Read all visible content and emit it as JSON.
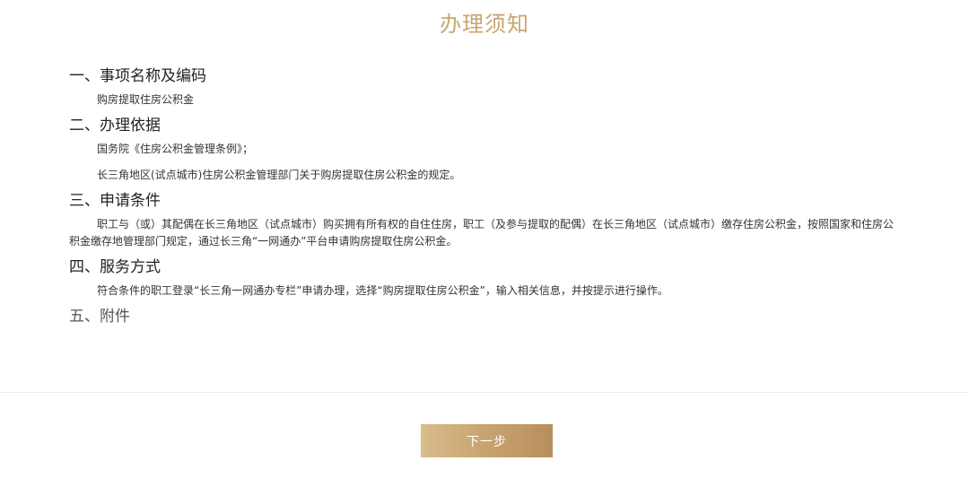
{
  "page": {
    "title": "办理须知"
  },
  "sections": [
    {
      "heading": "一、事项名称及编码",
      "paragraphs": [
        "购房提取住房公积金"
      ]
    },
    {
      "heading": "二、办理依据",
      "paragraphs": [
        "国务院《住房公积金管理条例》；",
        "长三角地区(试点城市)住房公积金管理部门关于购房提取住房公积金的规定。"
      ]
    },
    {
      "heading": "三、申请条件",
      "paragraphs": [
        "职工与（或）其配偶在长三角地区（试点城市）购买拥有所有权的自住住房，职工（及参与提取的配偶）在长三角地区（试点城市）缴存住房公积金，按照国家和住房公积金缴存地管理部门规定，通过长三角“一网通办”平台申请购房提取住房公积金。"
      ]
    },
    {
      "heading": "四、服务方式",
      "paragraphs": [
        "符合条件的职工登录“长三角一网通办专栏”申请办理，选择“购房提取住房公积金”，输入相关信息，并按提示进行操作。"
      ]
    },
    {
      "heading": "五、附件",
      "paragraphs": []
    }
  ],
  "footer": {
    "next_button_label": "下一步"
  },
  "colors": {
    "accent": "#c8a573",
    "button_gradient_start": "#d9bc8b",
    "button_gradient_end": "#b78f5d",
    "divider": "#ececec"
  }
}
